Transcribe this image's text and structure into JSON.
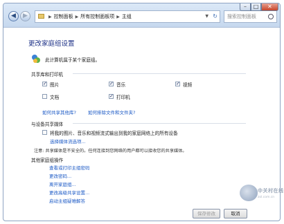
{
  "address_bar": {
    "crumbs": [
      "控制面板",
      "所有控制面板项",
      "主组"
    ]
  },
  "search": {
    "placeholder": "搜索控制面板"
  },
  "page": {
    "title": "更改家庭组设置",
    "member_text": "此计算机属于某个家庭组。"
  },
  "share_libraries": {
    "heading": "共享库和打印机",
    "items": [
      {
        "label": "图片",
        "checked": true
      },
      {
        "label": "音乐",
        "checked": true
      },
      {
        "label": "视频",
        "checked": true
      },
      {
        "label": "文档",
        "checked": false
      },
      {
        "label": "打印机",
        "checked": true
      }
    ],
    "link_share_other": "如何共享其他库?",
    "link_exclude": "如何排除文件和文件夹?"
  },
  "media": {
    "heading": "与设备共享媒体",
    "checkbox_label": "将我的图片、音乐和视频流式输出到我的家庭网络上的所有设备",
    "checked": false,
    "link_choose": "选择媒体流选项...",
    "note": "注意: 共享媒体是不安全的。任何连接到您网络的用户都可以接收您的共享媒体。"
  },
  "other_actions": {
    "heading": "其他家庭组操作",
    "links": [
      "查看或打印主组密码",
      "更改密码...",
      "离开家庭组...",
      "更改高级共享设置...",
      "启动主组疑难解答"
    ]
  },
  "buttons": {
    "save": "保存修改",
    "cancel": "取消"
  },
  "watermark": {
    "text": "中关村在线",
    "sub": "zol.com.cn"
  },
  "colors": {
    "title": "#1e3287",
    "link": "#1a58c5",
    "chrome": "#c6d8ee"
  }
}
